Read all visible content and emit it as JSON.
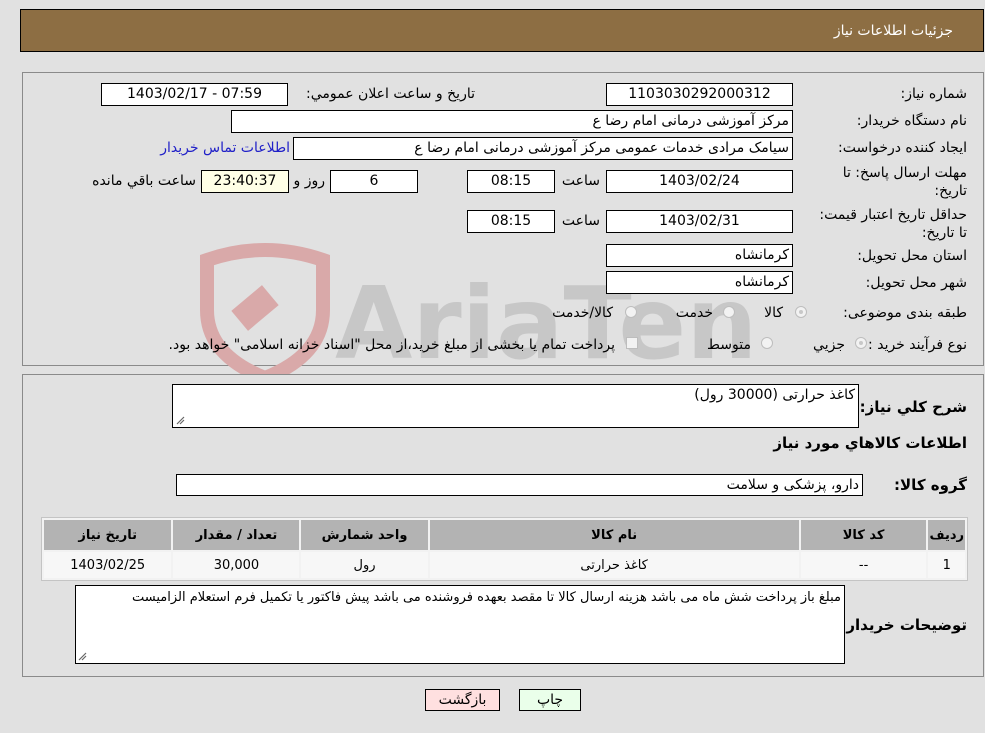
{
  "header": {
    "title": "جزئیات اطلاعات نیاز"
  },
  "form": {
    "need_number_label": "شماره نیاز:",
    "need_number": "1103030292000312",
    "announce_label": "تاريخ و ساعت اعلان عمومي:",
    "announce_value": "1403/02/17 - 07:59",
    "buyer_org_label": "نام دستگاه خریدار:",
    "buyer_org": "مرکز آموزشی  درمانی امام رضا  ع",
    "creator_label": "ایجاد کننده درخواست:",
    "creator": "سیامک مرادی خدمات عمومی مرکز آموزشی  درمانی امام رضا  ع",
    "contact_link": "اطلاعات تماس خریدار",
    "reply_deadline_label": "مهلت ارسال پاسخ: تا تاریخ:",
    "reply_date": "1403/02/24",
    "time_label": "ساعت",
    "reply_time": "08:15",
    "days_value": "6",
    "days_label": "روز و",
    "remaining_time": "23:40:37",
    "remaining_label": "ساعت باقي مانده",
    "price_validity_label": "حداقل تاریخ اعتبار قیمت: تا تاریخ:",
    "price_validity_date": "1403/02/31",
    "price_validity_time": "08:15",
    "province_label": "استان محل تحویل:",
    "province": "کرمانشاه",
    "city_label": "شهر محل تحویل:",
    "city": "کرمانشاه",
    "category_label": "طبقه بندی موضوعی:",
    "category_options": [
      "کالا",
      "خدمت",
      "کالا/خدمت"
    ],
    "category_selected": "کالا",
    "process_label": "نوع فرآیند خرید :",
    "process_options": [
      "جزيي",
      "متوسط"
    ],
    "process_selected": "جزيي",
    "treasury_note": "پرداخت تمام یا بخشی از مبلغ خرید،از محل \"اسناد خزانه اسلامی\" خواهد بود."
  },
  "details": {
    "description_label": "شرح کلي نياز:",
    "description": "کاغذ حرارتی (30000 رول)",
    "goods_info_title": "اطلاعات کالاهاي مورد نياز",
    "goods_group_label": "گروه کالا:",
    "goods_group": "دارو، پزشکی و سلامت",
    "table": {
      "headers": [
        "رديف",
        "کد کالا",
        "نام کالا",
        "واحد شمارش",
        "تعداد / مقدار",
        "تاریخ نیاز"
      ],
      "rows": [
        [
          "1",
          "--",
          "کاغذ حرارتی",
          "رول",
          "30,000",
          "1403/02/25"
        ]
      ]
    },
    "buyer_notes_label": "توضیحات خریدار:",
    "buyer_notes": "مبلغ باز پرداخت شش ماه می باشد هزینه ارسال کالا تا مقصد بعهده فروشنده می باشد پیش فاکتور یا تکمیل فرم استعلام الزامیست"
  },
  "buttons": {
    "print": "چاپ",
    "back": "بازگشت"
  },
  "colors": {
    "header_bg": "#8d6e43",
    "print_bg": "#eaffea",
    "back_bg": "#ffe0e0",
    "link": "#2020c8"
  },
  "watermark": "AriaTender.neT"
}
